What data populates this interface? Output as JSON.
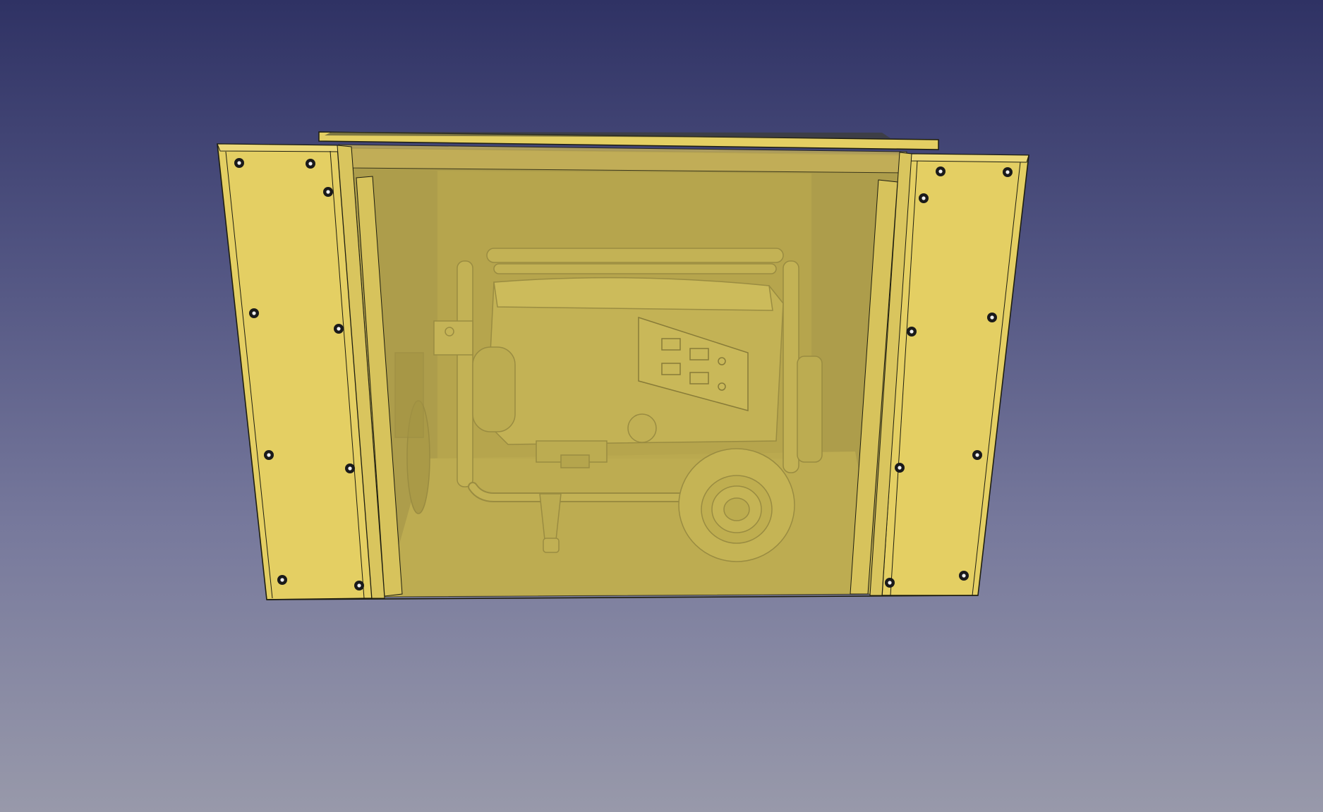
{
  "viewport": {
    "background_top": "#2f3264",
    "background_bottom": "#9899aa"
  },
  "model": {
    "panel_color": "#e4cf63",
    "panel_edge_color": "#1d1d10",
    "transparent_front_color": "#c9b24d",
    "interior_color": "#a0913f",
    "screw_head_color": "#1a1a1a",
    "screw_core_color": "#eeeeee",
    "contents_icon": "generator-icon",
    "enclosure_icon": "enclosure-box-icon"
  }
}
